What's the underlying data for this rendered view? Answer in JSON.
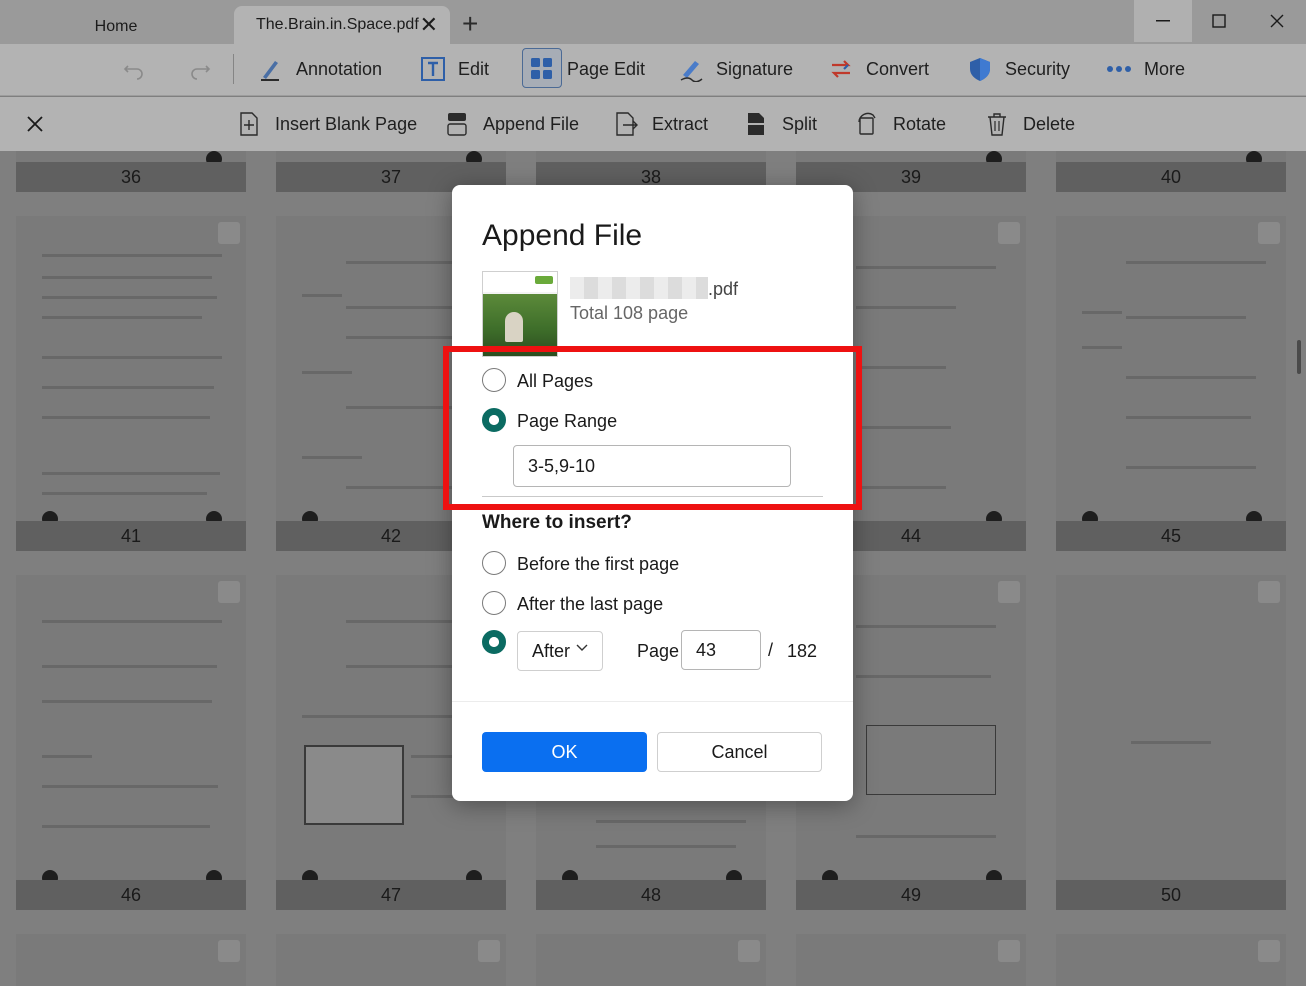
{
  "tabs": {
    "home": "Home",
    "document": "The.Brain.in.Space.pdf",
    "new_tab": "+"
  },
  "toolbar": {
    "annotation": "Annotation",
    "edit": "Edit",
    "page_edit": "Page Edit",
    "signature": "Signature",
    "convert": "Convert",
    "security": "Security",
    "more": "More"
  },
  "subbar": {
    "insert_blank_page": "Insert Blank Page",
    "append_file": "Append File",
    "extract": "Extract",
    "split": "Split",
    "rotate": "Rotate",
    "delete": "Delete"
  },
  "pages": {
    "row1": [
      "36",
      "37",
      "38",
      "39",
      "40"
    ],
    "row2": [
      "41",
      "42",
      "",
      "44",
      "45"
    ],
    "row3": [
      "46",
      "47",
      "48",
      "49",
      "50"
    ]
  },
  "dialog": {
    "title": "Append File",
    "file_name_ext": ".pdf",
    "file_pages": "Total 108 page",
    "option_all_pages": "All Pages",
    "option_page_range": "Page Range",
    "page_range_value": "3-5,9-10",
    "insert_heading": "Where to insert?",
    "insert_before_first": "Before the first page",
    "insert_after_last": "After the last page",
    "position_select": "After",
    "page_label": "Page",
    "page_value": "43",
    "page_separator": "/",
    "page_total": "182",
    "ok": "OK",
    "cancel": "Cancel"
  },
  "colors": {
    "accent": "#0a6ff0",
    "radio_selected": "#0b6b62",
    "highlight": "#ee1111"
  },
  "icons": {
    "undo": "undo-icon",
    "redo": "redo-icon",
    "annotation": "pen-icon",
    "edit": "text-edit-icon",
    "page_edit": "grid-icon",
    "signature": "signature-pen-icon",
    "convert": "convert-arrows-icon",
    "security": "shield-icon",
    "more": "more-dots-icon"
  }
}
